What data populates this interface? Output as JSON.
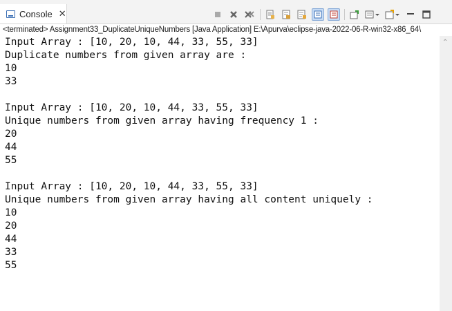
{
  "tab": {
    "label": "Console",
    "close": "✕"
  },
  "toolbar": {
    "icons": [
      "stop-icon",
      "remove-launch-icon",
      "remove-all-icon",
      "clear-console-icon",
      "scroll-lock-icon",
      "word-wrap-icon",
      "show-on-stdout-icon",
      "show-on-stderr-icon",
      "pin-console-icon",
      "display-selected-console-icon",
      "open-console-icon",
      "minimize-icon",
      "maximize-icon"
    ]
  },
  "path": "<terminated> Assignment33_DuplicateUniqueNumbers [Java Application] E:\\Apurva\\eclipse-java-2022-06-R-win32-x86_64\\",
  "console": {
    "lines": [
      "Input Array : [10, 20, 10, 44, 33, 55, 33]",
      "Duplicate numbers from given array are :",
      "10",
      "33",
      "",
      "Input Array : [10, 20, 10, 44, 33, 55, 33]",
      "Unique numbers from given array having frequency 1 :",
      "20",
      "44",
      "55",
      "",
      "Input Array : [10, 20, 10, 44, 33, 55, 33]",
      "Unique numbers from given array having all content uniquely :",
      "10",
      "20",
      "44",
      "33",
      "55"
    ]
  }
}
